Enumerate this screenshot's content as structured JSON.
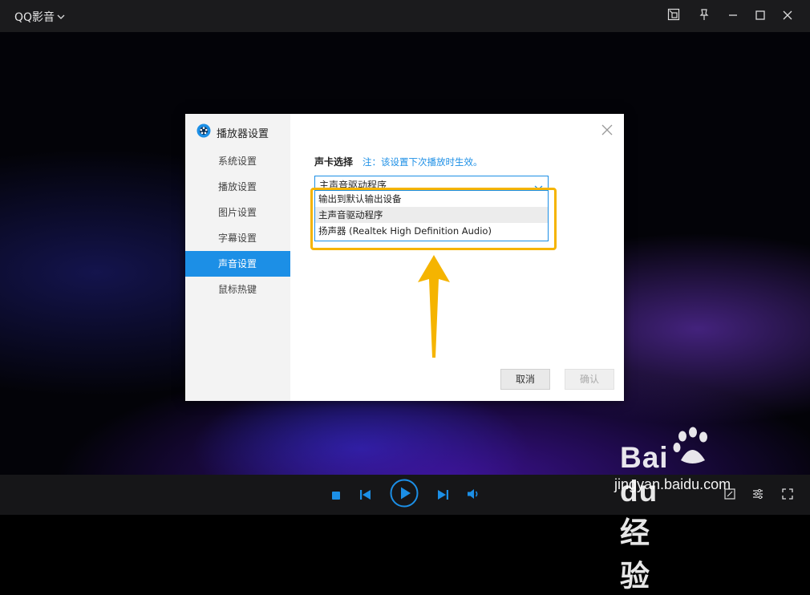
{
  "window": {
    "title": "QQ影音"
  },
  "dialog": {
    "title": "播放器设置",
    "sidebar": [
      {
        "label": "系统设置",
        "active": false
      },
      {
        "label": "播放设置",
        "active": false
      },
      {
        "label": "图片设置",
        "active": false
      },
      {
        "label": "字幕设置",
        "active": false
      },
      {
        "label": "声音设置",
        "active": true
      },
      {
        "label": "鼠标热键",
        "active": false
      }
    ],
    "sound_card_label": "声卡选择",
    "sound_card_note": "注：该设置下次播放时生效。",
    "selected_device": "主声音驱动程序",
    "options": [
      {
        "label": "输出到默认输出设备",
        "hover": false
      },
      {
        "label": "主声音驱动程序",
        "hover": true
      },
      {
        "label": "扬声器 (Realtek High Definition Audio)",
        "hover": false
      }
    ],
    "cancel_label": "取消",
    "ok_label": "确认"
  },
  "colors": {
    "accent": "#1c8fe6",
    "highlight": "#f5b400"
  },
  "watermark": {
    "brand": "Bai du 经验",
    "url": "jingyan.baidu.com"
  }
}
